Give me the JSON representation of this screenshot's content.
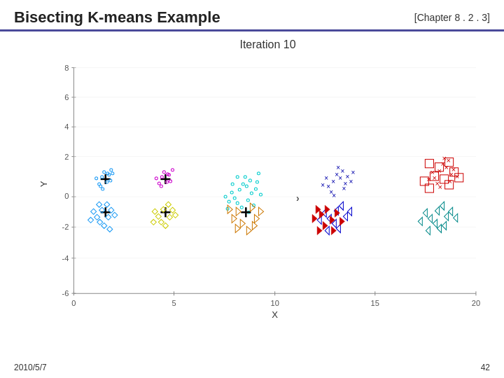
{
  "header": {
    "title": "Bisecting K-means Example",
    "chapter": "[Chapter 8 . 2 . 3]"
  },
  "chart": {
    "iteration_label": "Iteration 10",
    "x_label": "X",
    "y_label": "Y",
    "x_ticks": [
      "0",
      "5",
      "10",
      "15",
      "20"
    ],
    "y_ticks": [
      "8",
      "6",
      "4",
      "2",
      "0",
      "-2",
      "-4",
      "-6"
    ]
  },
  "footer": {
    "date": "2010/5/7",
    "page": "42"
  }
}
